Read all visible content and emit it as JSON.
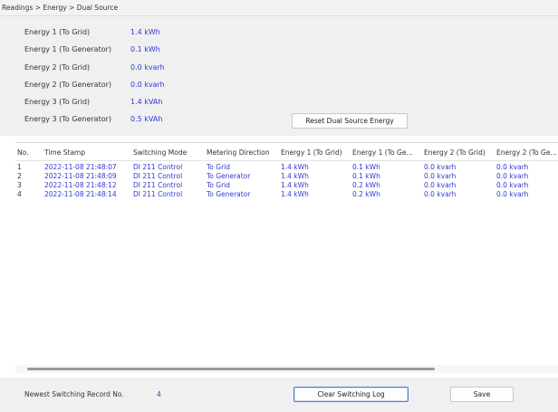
{
  "breadcrumb": "Readings > Energy > Dual Source",
  "summary": [
    {
      "label": "Energy 1 (To Grid)",
      "value": "1.4 kWh"
    },
    {
      "label": "Energy 1 (To Generator)",
      "value": "0.1 kWh"
    },
    {
      "label": "Energy 2 (To Grid)",
      "value": "0.0 kvarh"
    },
    {
      "label": "Energy 2 (To Generator)",
      "value": "0.0 kvarh"
    },
    {
      "label": "Energy 3 (To Grid)",
      "value": "1.4 kVAh"
    },
    {
      "label": "Energy 3 (To Generator)",
      "value": "0.5 kVAh"
    }
  ],
  "reset_button": "Reset Dual Source Energy",
  "table": {
    "headers": [
      "No.",
      "Time Stamp",
      "Switching Mode",
      "Metering Direction",
      "Energy 1 (To Grid)",
      "Energy 1 (To Ge...",
      "Energy 2 (To Grid)",
      "Energy 2 (To Ge..."
    ],
    "rows": [
      [
        "1",
        "2022-11-08 21:48:07",
        "DI 211 Control",
        "To Grid",
        "1.4 kWh",
        "0.1 kWh",
        "0.0 kvarh",
        "0.0 kvarh"
      ],
      [
        "2",
        "2022-11-08 21:48:09",
        "DI 211 Control",
        "To Generator",
        "1.4 kWh",
        "0.1 kWh",
        "0.0 kvarh",
        "0.0 kvarh"
      ],
      [
        "3",
        "2022-11-08 21:48:12",
        "DI 211 Control",
        "To Grid",
        "1.4 kWh",
        "0.2 kWh",
        "0.0 kvarh",
        "0.0 kvarh"
      ],
      [
        "4",
        "2022-11-08 21:48:14",
        "DI 211 Control",
        "To Generator",
        "1.4 kWh",
        "0.2 kWh",
        "0.0 kvarh",
        "0.0 kvarh"
      ]
    ]
  },
  "footer": {
    "newest_label": "Newest Switching Record No.",
    "newest_value": "4",
    "clear_button": "Clear Switching Log",
    "save_button": "Save"
  },
  "colors": {
    "value_blue": "#2f3ad1",
    "panel_gray": "#f0f0f0"
  }
}
